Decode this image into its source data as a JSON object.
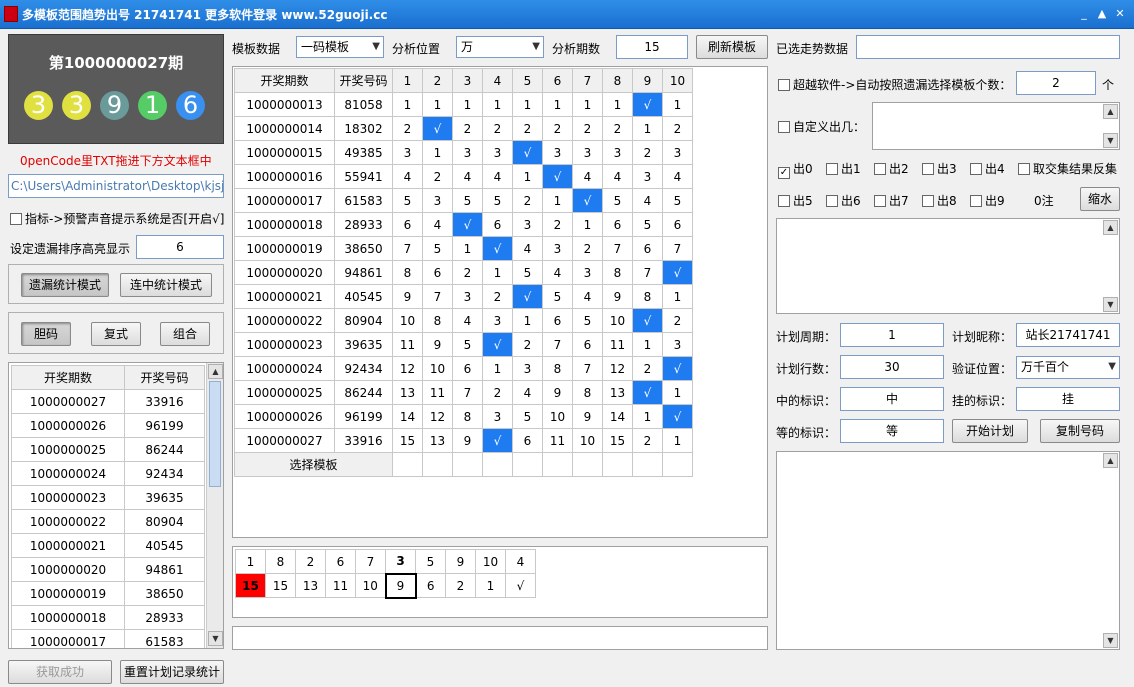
{
  "window": {
    "title": "多模板范围趋势出号 21741741 更多软件登录 www.52guoji.cc",
    "min": "_",
    "max": "▲",
    "close": "✕"
  },
  "draw": {
    "period": "第1000000027期",
    "balls": [
      "3",
      "3",
      "9",
      "1",
      "6"
    ],
    "ball_colors": [
      "#e0e040",
      "#e0e040",
      "#6b9a9a",
      "#55cc66",
      "#3a90f0"
    ]
  },
  "left": {
    "hint": "0penCode里TXT拖进下方文本框中",
    "path": "C:\\Users\\Administrator\\Desktop\\kjsj.",
    "alarm_label": "指标->预警声音提示系统是否[开启√]",
    "highlight_label": "设定遗漏排序高亮显示",
    "highlight_value": "6",
    "mode_buttons": [
      "遗漏统计模式",
      "连中统计模式"
    ],
    "type_buttons": [
      "胆码",
      "复式",
      "组合"
    ],
    "history_headers": [
      "开奖期数",
      "开奖号码"
    ],
    "history": [
      [
        "1000000027",
        "33916"
      ],
      [
        "1000000026",
        "96199"
      ],
      [
        "1000000025",
        "86244"
      ],
      [
        "1000000024",
        "92434"
      ],
      [
        "1000000023",
        "39635"
      ],
      [
        "1000000022",
        "80904"
      ],
      [
        "1000000021",
        "40545"
      ],
      [
        "1000000020",
        "94861"
      ],
      [
        "1000000019",
        "38650"
      ],
      [
        "1000000018",
        "28933"
      ],
      [
        "1000000017",
        "61583"
      ]
    ],
    "get_btn": "获取成功",
    "reset_btn": "重置计划记录统计"
  },
  "controls": {
    "template_label": "模板数据",
    "template_value": "一码模板",
    "position_label": "分析位置",
    "position_value": "万",
    "periods_label": "分析期数",
    "periods_value": "15",
    "refresh_btn": "刷新模板"
  },
  "main_table": {
    "headers": [
      "开奖期数",
      "开奖号码",
      "1",
      "2",
      "3",
      "4",
      "5",
      "6",
      "7",
      "8",
      "9",
      "10"
    ],
    "rows": [
      {
        "p": "1000000013",
        "n": "81058",
        "c": [
          "1",
          "1",
          "1",
          "1",
          "1",
          "1",
          "1",
          "1",
          "√",
          "1"
        ]
      },
      {
        "p": "1000000014",
        "n": "18302",
        "c": [
          "2",
          "√",
          "2",
          "2",
          "2",
          "2",
          "2",
          "2",
          "1",
          "2"
        ]
      },
      {
        "p": "1000000015",
        "n": "49385",
        "c": [
          "3",
          "1",
          "3",
          "3",
          "√",
          "3",
          "3",
          "3",
          "2",
          "3"
        ]
      },
      {
        "p": "1000000016",
        "n": "55941",
        "c": [
          "4",
          "2",
          "4",
          "4",
          "1",
          "√",
          "4",
          "4",
          "3",
          "4"
        ]
      },
      {
        "p": "1000000017",
        "n": "61583",
        "c": [
          "5",
          "3",
          "5",
          "5",
          "2",
          "1",
          "√",
          "5",
          "4",
          "5"
        ]
      },
      {
        "p": "1000000018",
        "n": "28933",
        "c": [
          "6",
          "4",
          "√",
          "6",
          "3",
          "2",
          "1",
          "6",
          "5",
          "6"
        ]
      },
      {
        "p": "1000000019",
        "n": "38650",
        "c": [
          "7",
          "5",
          "1",
          "√",
          "4",
          "3",
          "2",
          "7",
          "6",
          "7"
        ]
      },
      {
        "p": "1000000020",
        "n": "94861",
        "c": [
          "8",
          "6",
          "2",
          "1",
          "5",
          "4",
          "3",
          "8",
          "7",
          "√"
        ]
      },
      {
        "p": "1000000021",
        "n": "40545",
        "c": [
          "9",
          "7",
          "3",
          "2",
          "√",
          "5",
          "4",
          "9",
          "8",
          "1"
        ]
      },
      {
        "p": "1000000022",
        "n": "80904",
        "c": [
          "10",
          "8",
          "4",
          "3",
          "1",
          "6",
          "5",
          "10",
          "√",
          "2"
        ]
      },
      {
        "p": "1000000023",
        "n": "39635",
        "c": [
          "11",
          "9",
          "5",
          "√",
          "2",
          "7",
          "6",
          "11",
          "1",
          "3"
        ]
      },
      {
        "p": "1000000024",
        "n": "92434",
        "c": [
          "12",
          "10",
          "6",
          "1",
          "3",
          "8",
          "7",
          "12",
          "2",
          "√"
        ]
      },
      {
        "p": "1000000025",
        "n": "86244",
        "c": [
          "13",
          "11",
          "7",
          "2",
          "4",
          "9",
          "8",
          "13",
          "√",
          "1"
        ]
      },
      {
        "p": "1000000026",
        "n": "96199",
        "c": [
          "14",
          "12",
          "8",
          "3",
          "5",
          "10",
          "9",
          "14",
          "1",
          "√"
        ]
      },
      {
        "p": "1000000027",
        "n": "33916",
        "c": [
          "15",
          "13",
          "9",
          "√",
          "6",
          "11",
          "10",
          "15",
          "2",
          "1"
        ]
      }
    ],
    "footer": "选择模板"
  },
  "summary": {
    "top": [
      "1",
      "8",
      "2",
      "6",
      "7",
      "3",
      "5",
      "9",
      "10",
      "4"
    ],
    "bottom": [
      "15",
      "15",
      "13",
      "11",
      "10",
      "9",
      "6",
      "2",
      "1",
      "√"
    ]
  },
  "right": {
    "selected_label": "已选走势数据",
    "beyond_label": "超越软件->自动按照遗漏选择模板个数：",
    "beyond_value": "2",
    "beyond_unit": "个",
    "custom_label": "自定义出几：",
    "outs_row1": [
      "出0",
      "出1",
      "出2",
      "出3",
      "出4",
      "取交集结果反集"
    ],
    "outs_row2": [
      "出5",
      "出6",
      "出7",
      "出8",
      "出9"
    ],
    "count_text": "0注",
    "shrink_btn": "缩水",
    "cycle_label": "计划周期：",
    "cycle_value": "1",
    "nick_label": "计划昵称：",
    "nick_value": "站长21741741",
    "rows_label": "计划行数：",
    "rows_value": "30",
    "verify_label": "验证位置：",
    "verify_value": "万千百个",
    "hit_label": "中的标识：",
    "hit_value": "中",
    "miss_label": "挂的标识：",
    "miss_value": "挂",
    "wait_label": "等的标识：",
    "wait_value": "等",
    "start_btn": "开始计划",
    "copy_btn": "复制号码"
  }
}
